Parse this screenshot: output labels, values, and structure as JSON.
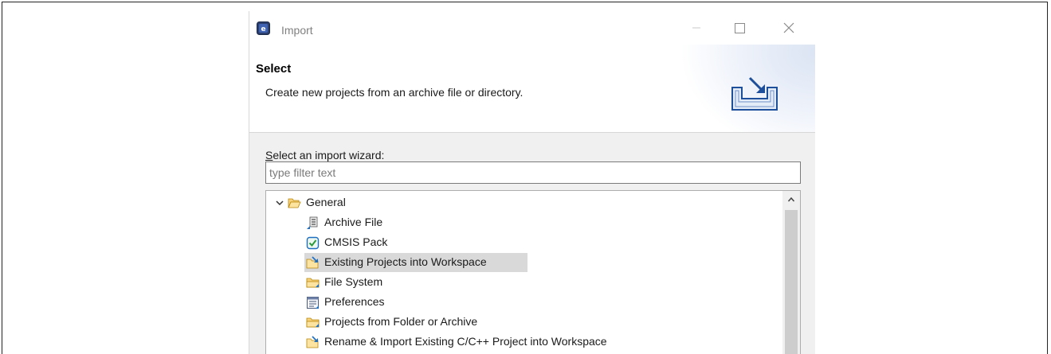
{
  "window": {
    "title": "Import"
  },
  "header": {
    "title": "Select",
    "description": "Create new projects from an archive file or directory."
  },
  "wizard": {
    "label_mnemonic": "S",
    "label_rest": "elect an import wizard:",
    "filter_placeholder": "type filter text",
    "filter_value": ""
  },
  "tree": {
    "group": {
      "label": "General",
      "expanded": true
    },
    "items": [
      {
        "label": "Archive File",
        "icon": "archive-file-icon",
        "selected": false
      },
      {
        "label": "CMSIS Pack",
        "icon": "cmsis-pack-icon",
        "selected": false
      },
      {
        "label": "Existing Projects into Workspace",
        "icon": "existing-projects-icon",
        "selected": true
      },
      {
        "label": "File System",
        "icon": "folder-icon",
        "selected": false
      },
      {
        "label": "Preferences",
        "icon": "preferences-icon",
        "selected": false
      },
      {
        "label": "Projects from Folder or Archive",
        "icon": "folder-icon",
        "selected": false
      },
      {
        "label": "Rename & Import Existing C/C++ Project into Workspace",
        "icon": "rename-import-icon",
        "selected": false
      }
    ]
  },
  "colors": {
    "accent": "#1e6fc2",
    "selection": "#d9d9d9",
    "folder": "#f3c65a",
    "check": "#2b9a3c"
  }
}
